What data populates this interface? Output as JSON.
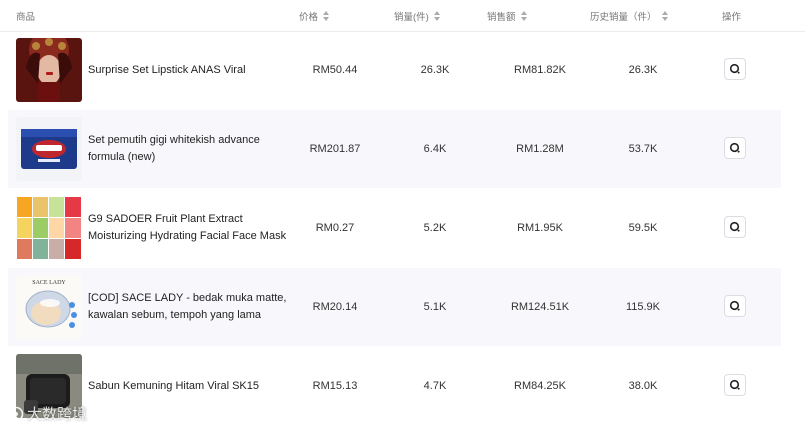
{
  "columns": {
    "product": "商品",
    "price": "价格",
    "sales": "销量(件)",
    "gmv": "销售额",
    "history_sales": "历史销量（件）",
    "action": "操作"
  },
  "rows": [
    {
      "name": "Surprise Set Lipstick ANAS Viral",
      "price": "RM50.44",
      "sales": "26.3K",
      "gmv": "RM81.82K",
      "history_sales": "26.3K"
    },
    {
      "name": "Set pemutih gigi whitekish advance formula (new)",
      "price": "RM201.87",
      "sales": "6.4K",
      "gmv": "RM1.28M",
      "history_sales": "53.7K"
    },
    {
      "name": "G9 SADOER Fruit Plant Extract Moisturizing Hydrating Facial Face Mask",
      "price": "RM0.27",
      "sales": "5.2K",
      "gmv": "RM1.95K",
      "history_sales": "59.5K"
    },
    {
      "name": "[COD] SACE LADY - bedak muka matte, kawalan sebum, tempoh yang lama",
      "price": "RM20.14",
      "sales": "5.1K",
      "gmv": "RM124.51K",
      "history_sales": "115.9K"
    },
    {
      "name": "Sabun Kemuning Hitam Viral SK15",
      "price": "RM15.13",
      "sales": "4.7K",
      "gmv": "RM84.25K",
      "history_sales": "38.0K"
    }
  ],
  "product_images": {
    "row1_caption": "",
    "row2_caption": "",
    "row4_caption": "SACE LADY"
  },
  "watermark": "大数跨境",
  "icons": {
    "sort": "sort-icon",
    "action": "search-icon"
  }
}
